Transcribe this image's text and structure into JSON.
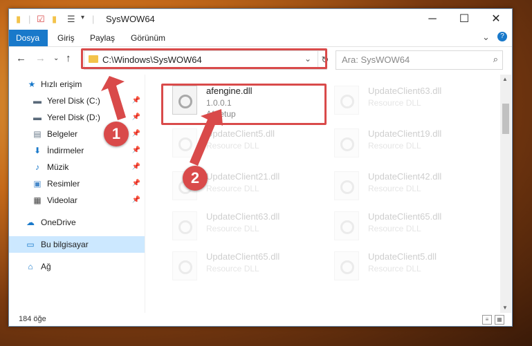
{
  "window": {
    "title": "SysWOW64"
  },
  "ribbon": {
    "tabs": [
      "Dosya",
      "Giriş",
      "Paylaş",
      "Görünüm"
    ]
  },
  "address": {
    "path": "C:\\Windows\\SysWOW64",
    "search_placeholder": "Ara: SysWOW64"
  },
  "sidebar": {
    "items": [
      {
        "label": "Hızlı erişim",
        "icon": "star-icon"
      },
      {
        "label": "Yerel Disk (C:)",
        "icon": "drive-icon",
        "pinned": true
      },
      {
        "label": "Yerel Disk (D:)",
        "icon": "drive-icon",
        "pinned": true
      },
      {
        "label": "Belgeler",
        "icon": "documents-icon",
        "pinned": true
      },
      {
        "label": "İndirmeler",
        "icon": "download-icon",
        "pinned": true
      },
      {
        "label": "Müzik",
        "icon": "music-icon",
        "pinned": true
      },
      {
        "label": "Resimler",
        "icon": "pictures-icon",
        "pinned": true
      },
      {
        "label": "Videolar",
        "icon": "video-icon",
        "pinned": true
      },
      {
        "label": "OneDrive",
        "icon": "cloud-icon"
      },
      {
        "label": "Bu bilgisayar",
        "icon": "computer-icon",
        "selected": true
      },
      {
        "label": "Ağ",
        "icon": "network-icon"
      }
    ]
  },
  "files": [
    {
      "name": "afengine.dll",
      "line2": "1.0.0.1",
      "line3": "AfSetup",
      "faded": false
    },
    {
      "name": "UpdateClient63.dll",
      "line2": "Resource DLL",
      "faded": true
    },
    {
      "name": "UpdateClient5.dll",
      "line2": "Resource DLL",
      "faded": true
    },
    {
      "name": "UpdateClient19.dll",
      "line2": "Resource DLL",
      "faded": true
    },
    {
      "name": "UpdateClient21.dll",
      "line2": "Resource DLL",
      "faded": true
    },
    {
      "name": "UpdateClient42.dll",
      "line2": "Resource DLL",
      "faded": true
    },
    {
      "name": "UpdateClient63.dll",
      "line2": "Resource DLL",
      "faded": true
    },
    {
      "name": "UpdateClient65.dll",
      "line2": "Resource DLL",
      "faded": true
    },
    {
      "name": "UpdateClient65.dll",
      "line2": "Resource DLL",
      "faded": true
    },
    {
      "name": "UpdateClient5.dll",
      "line2": "Resource DLL",
      "faded": true
    }
  ],
  "status": {
    "count": "184 öğe"
  },
  "callouts": [
    "1",
    "2"
  ],
  "colors": {
    "accent": "#1979ca",
    "highlight": "#d94a4a",
    "selected": "#cce8ff"
  }
}
